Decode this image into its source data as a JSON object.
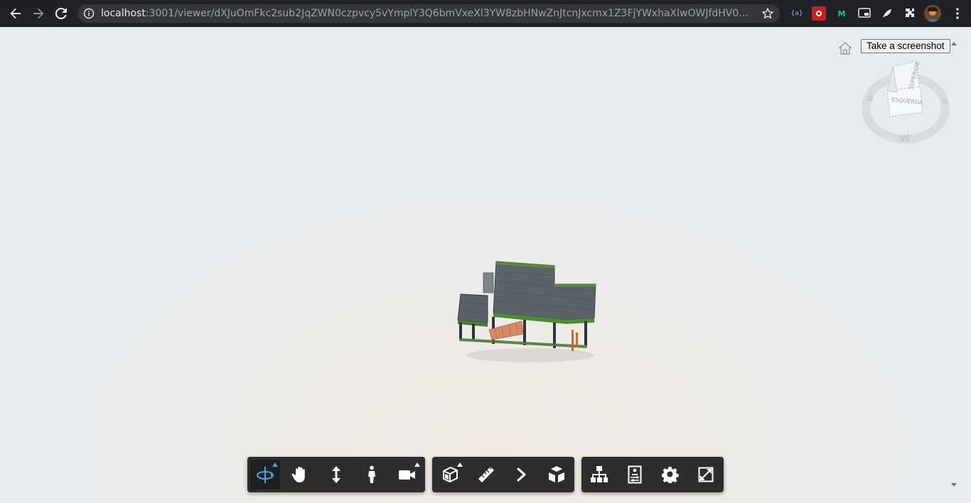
{
  "browser": {
    "url_host": "localhost",
    "url_rest": ":3001/viewer/dXJuOmFkc2sub2JqZWN0czpvcy5vYmplY3Q6bmVxeXl3YW8zbHNwZnJtcnJxcmx1Z3FjYWxhaXlwOWJfdHV0b3JpYWx...",
    "nav": {
      "back": "back-arrow",
      "forward": "forward-arrow",
      "reload": "reload"
    },
    "extensions": [
      {
        "name": "json-ext-icon",
        "label": "{a}"
      },
      {
        "name": "red-ext-icon",
        "label": ""
      },
      {
        "name": "mailchimp-icon",
        "label": "M"
      },
      {
        "name": "screen-ext-icon",
        "label": ""
      },
      {
        "name": "feather-ext-icon",
        "label": ""
      },
      {
        "name": "puzzle-icon",
        "label": ""
      },
      {
        "name": "profile-avatar",
        "label": ""
      }
    ]
  },
  "viewer": {
    "screenshot_button": "Take a screenshot",
    "viewcube": {
      "top_face": "SUPERIOR",
      "front_face": "ESQUERDA",
      "compass_n": "N",
      "compass_w": "W",
      "compass_e": "S"
    },
    "toolbar": {
      "navigation": [
        {
          "name": "orbit-tool",
          "icon": "orbit-icon",
          "active": true,
          "submenu": true
        },
        {
          "name": "pan-tool",
          "icon": "hand-icon",
          "active": false,
          "submenu": false
        },
        {
          "name": "zoom-tool",
          "icon": "zoom-vertical-arrows-icon",
          "active": false,
          "submenu": false
        },
        {
          "name": "first-person-tool",
          "icon": "person-icon",
          "active": false,
          "submenu": false
        },
        {
          "name": "camera-tool",
          "icon": "camera-icon",
          "active": false,
          "submenu": true
        }
      ],
      "modeling": [
        {
          "name": "section-tool",
          "icon": "section-box-icon",
          "active": false,
          "submenu": true
        },
        {
          "name": "measure-tool",
          "icon": "ruler-icon",
          "active": false,
          "submenu": false
        },
        {
          "name": "next-tool",
          "icon": "chevron-right-icon",
          "active": false,
          "submenu": false
        },
        {
          "name": "explode-tool",
          "icon": "explode-cube-icon",
          "active": false,
          "submenu": false
        }
      ],
      "settings": [
        {
          "name": "model-browser-tool",
          "icon": "hierarchy-icon",
          "active": false,
          "submenu": false
        },
        {
          "name": "properties-tool",
          "icon": "properties-icon",
          "active": false,
          "submenu": false
        },
        {
          "name": "settings-tool",
          "icon": "gear-icon",
          "active": false,
          "submenu": false
        },
        {
          "name": "fullscreen-tool",
          "icon": "fullscreen-icon",
          "active": false,
          "submenu": false
        }
      ]
    },
    "colors": {
      "toolbar_bg": "#2d2d2d",
      "accent": "#4aa7e0",
      "icon": "#ffffff"
    }
  }
}
